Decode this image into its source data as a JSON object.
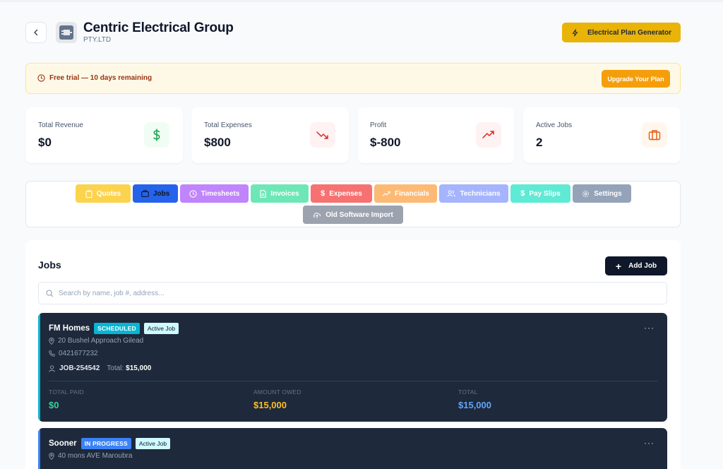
{
  "header": {
    "company_name": "Centric Electrical Group",
    "company_sub": "PTY.LTD",
    "generator_button": "Electrical Plan Generator"
  },
  "trial": {
    "message": "Free trial — 10 days remaining",
    "upgrade_button": "Upgrade Your Plan"
  },
  "stats": [
    {
      "label": "Total Revenue",
      "value": "$0",
      "icon": "dollar-icon",
      "color": "#16a34a"
    },
    {
      "label": "Total Expenses",
      "value": "$800",
      "icon": "trend-down-icon",
      "color": "#dc2626"
    },
    {
      "label": "Profit",
      "value": "$-800",
      "icon": "trend-up-icon",
      "color": "#dc2626"
    },
    {
      "label": "Active Jobs",
      "value": "2",
      "icon": "briefcase-icon",
      "color": "#ea580c"
    }
  ],
  "tabs": [
    {
      "label": "Quotes",
      "color": "#fcd34d",
      "active": false
    },
    {
      "label": "Jobs",
      "color": "#2563eb",
      "active": true
    },
    {
      "label": "Timesheets",
      "color": "#c084fc",
      "active": false
    },
    {
      "label": "Invoices",
      "color": "#6ee7b7",
      "active": false
    },
    {
      "label": "Expenses",
      "color": "#f87171",
      "active": false
    },
    {
      "label": "Financials",
      "color": "#fdba74",
      "active": false
    },
    {
      "label": "Technicians",
      "color": "#a5b4fc",
      "active": false
    },
    {
      "label": "Pay Slips",
      "color": "#5eead4",
      "active": false
    },
    {
      "label": "Settings",
      "color": "#94a3b8",
      "active": false
    },
    {
      "label": "Old Software Import",
      "color": "#9ca3af",
      "active": false
    }
  ],
  "jobs": {
    "title": "Jobs",
    "add_button": "Add Job",
    "search_placeholder": "Search by name, job #, address...",
    "cards": [
      {
        "name": "FM Homes",
        "status": "SCHEDULED",
        "status_color": "#06b6d4",
        "active_label": "Active Job",
        "address": "20 Bushel Approach Gilead",
        "phone": "0421677232",
        "job_number": "JOB-254542",
        "total_label": "Total:",
        "total": "$15,000",
        "paid_label": "TOTAL PAID",
        "paid": "$0",
        "owed_label": "AMOUNT OWED",
        "owed": "$15,000",
        "grand_label": "TOTAL",
        "grand": "$15,000"
      },
      {
        "name": "Sooner",
        "status": "IN PROGRESS",
        "status_color": "#3b82f6",
        "active_label": "Active Job",
        "address": "40 mons AVE Maroubra"
      }
    ]
  },
  "colors": {
    "paid": "#34d399",
    "owed": "#fbbf24",
    "grand": "#60a5fa"
  }
}
